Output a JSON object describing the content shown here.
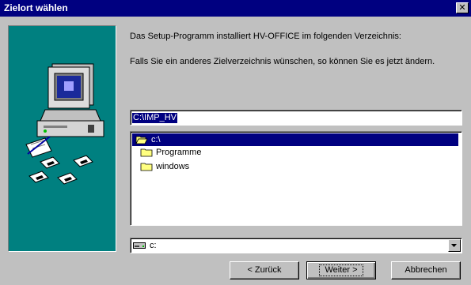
{
  "window": {
    "title": "Zielort wählen",
    "close_glyph": "✕"
  },
  "artwork": {
    "icon": "computer-with-disks-icon",
    "background_color": "#008080"
  },
  "message": {
    "line1": "Das Setup-Programm installiert HV-OFFICE im folgenden Verzeichnis:",
    "line2": "Falls Sie ein anderes Zielverzeichnis wünschen, so können Sie es jetzt ändern."
  },
  "path_input": {
    "value": "C:\\IMP_HV"
  },
  "directory_list": {
    "items": [
      {
        "label": "c:\\",
        "icon": "open-folder-icon",
        "selected": true
      },
      {
        "label": "Programme",
        "icon": "folder-icon",
        "selected": false
      },
      {
        "label": "windows",
        "icon": "folder-icon",
        "selected": false
      }
    ]
  },
  "drive_combo": {
    "value": "c:",
    "icon": "hard-drive-icon"
  },
  "buttons": {
    "back": "< Zurück",
    "next": "Weiter >",
    "cancel": "Abbrechen"
  },
  "colors": {
    "titlebar": "#000080",
    "selection": "#000080",
    "face": "#c0c0c0"
  }
}
